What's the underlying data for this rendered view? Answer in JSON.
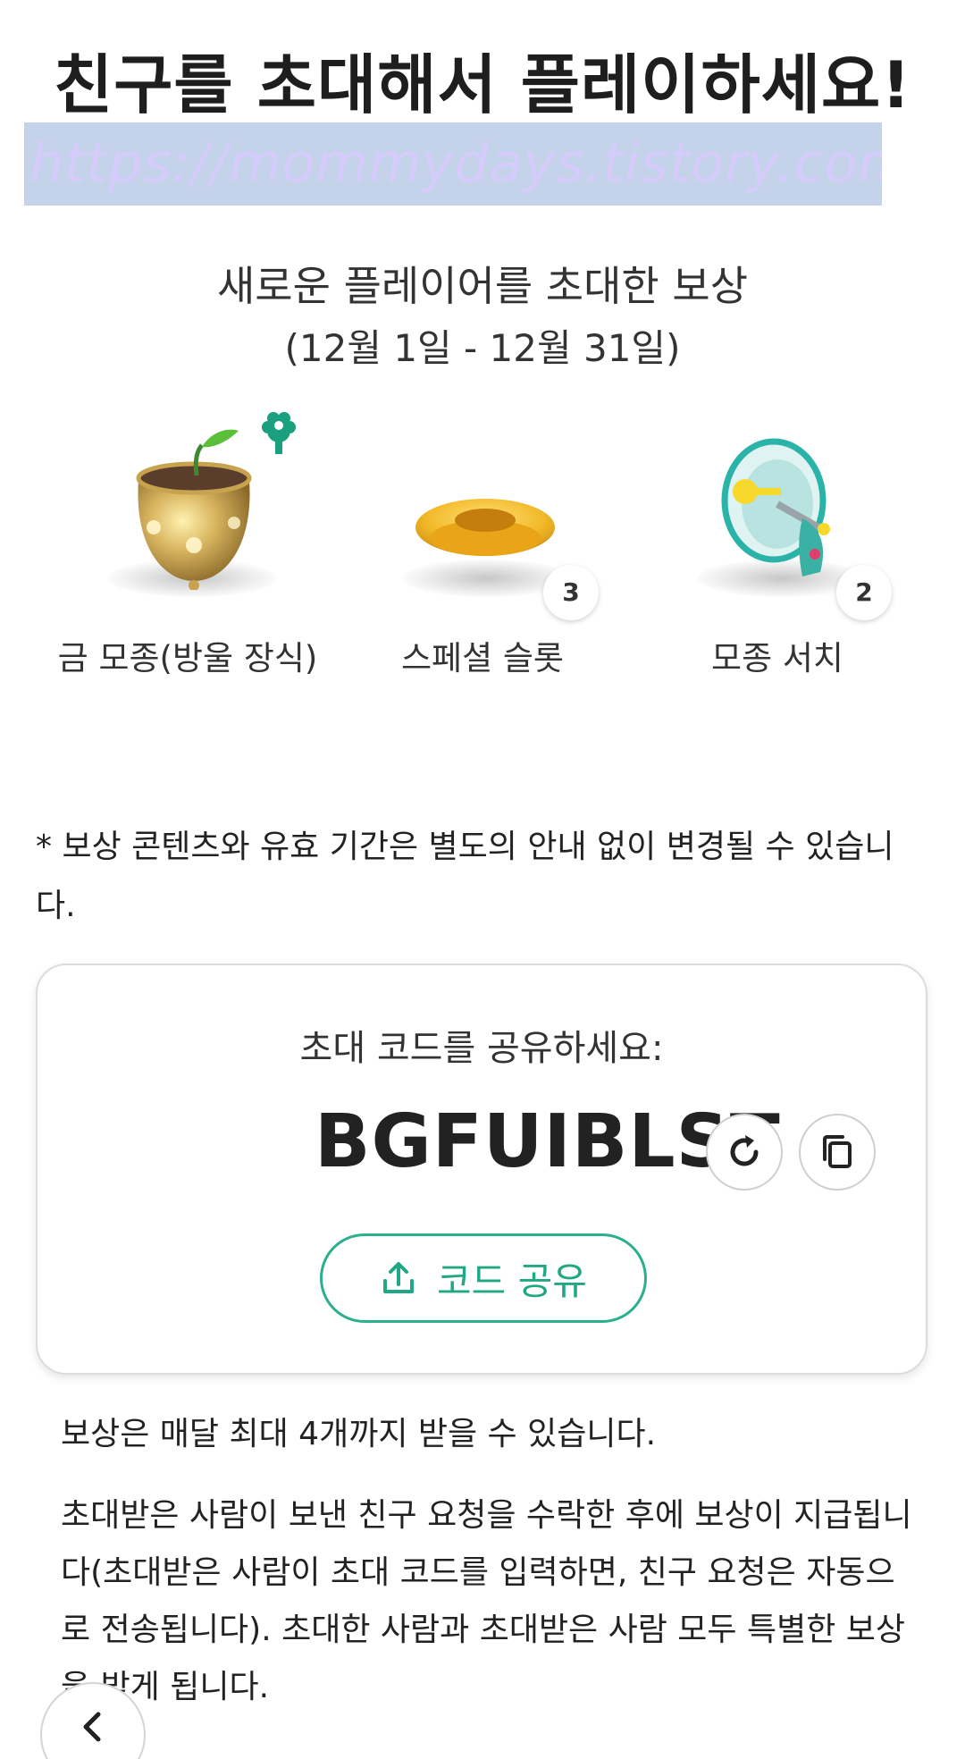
{
  "header": {
    "title": "친구를 초대해서 플레이하세요!",
    "watermark": "https://mommydays.tistory.com"
  },
  "rewards": {
    "title": "새로운 플레이어를 초대한 보상",
    "dates": "(12월 1일 - 12월 31일)",
    "items": [
      {
        "label": "금 모종(방울 장식)",
        "icon": "golden-flowerpot-icon",
        "count": null
      },
      {
        "label": "스페셜 슬롯",
        "icon": "golden-slot-icon",
        "count": "3"
      },
      {
        "label": "모종 서치",
        "icon": "megaphone-icon",
        "count": "2"
      }
    ]
  },
  "notice": "* 보상 콘텐츠와 유효 기간은 별도의 안내 없이 변경될 수 있습니다.",
  "invite": {
    "prompt": "초대 코드를 공유하세요:",
    "code": "BGFUIBLST",
    "share_label": "코드 공유"
  },
  "info": {
    "line1": "보상은 매달 최대 4개까지 받을 수 있습니다.",
    "line2": "초대받은 사람이 보낸 친구 요청을 수락한 후에 보상이 지급됩니다(초대받은 사람이 초대 코드를 입력하면, 친구 요청은 자동으로 전송됩니다). 초대한 사람과 초대받은 사람 모두 특별한 보상을 받게 됩니다."
  },
  "colors": {
    "accent": "#2bb08e",
    "watermark_bg": "#c4d3ea"
  }
}
